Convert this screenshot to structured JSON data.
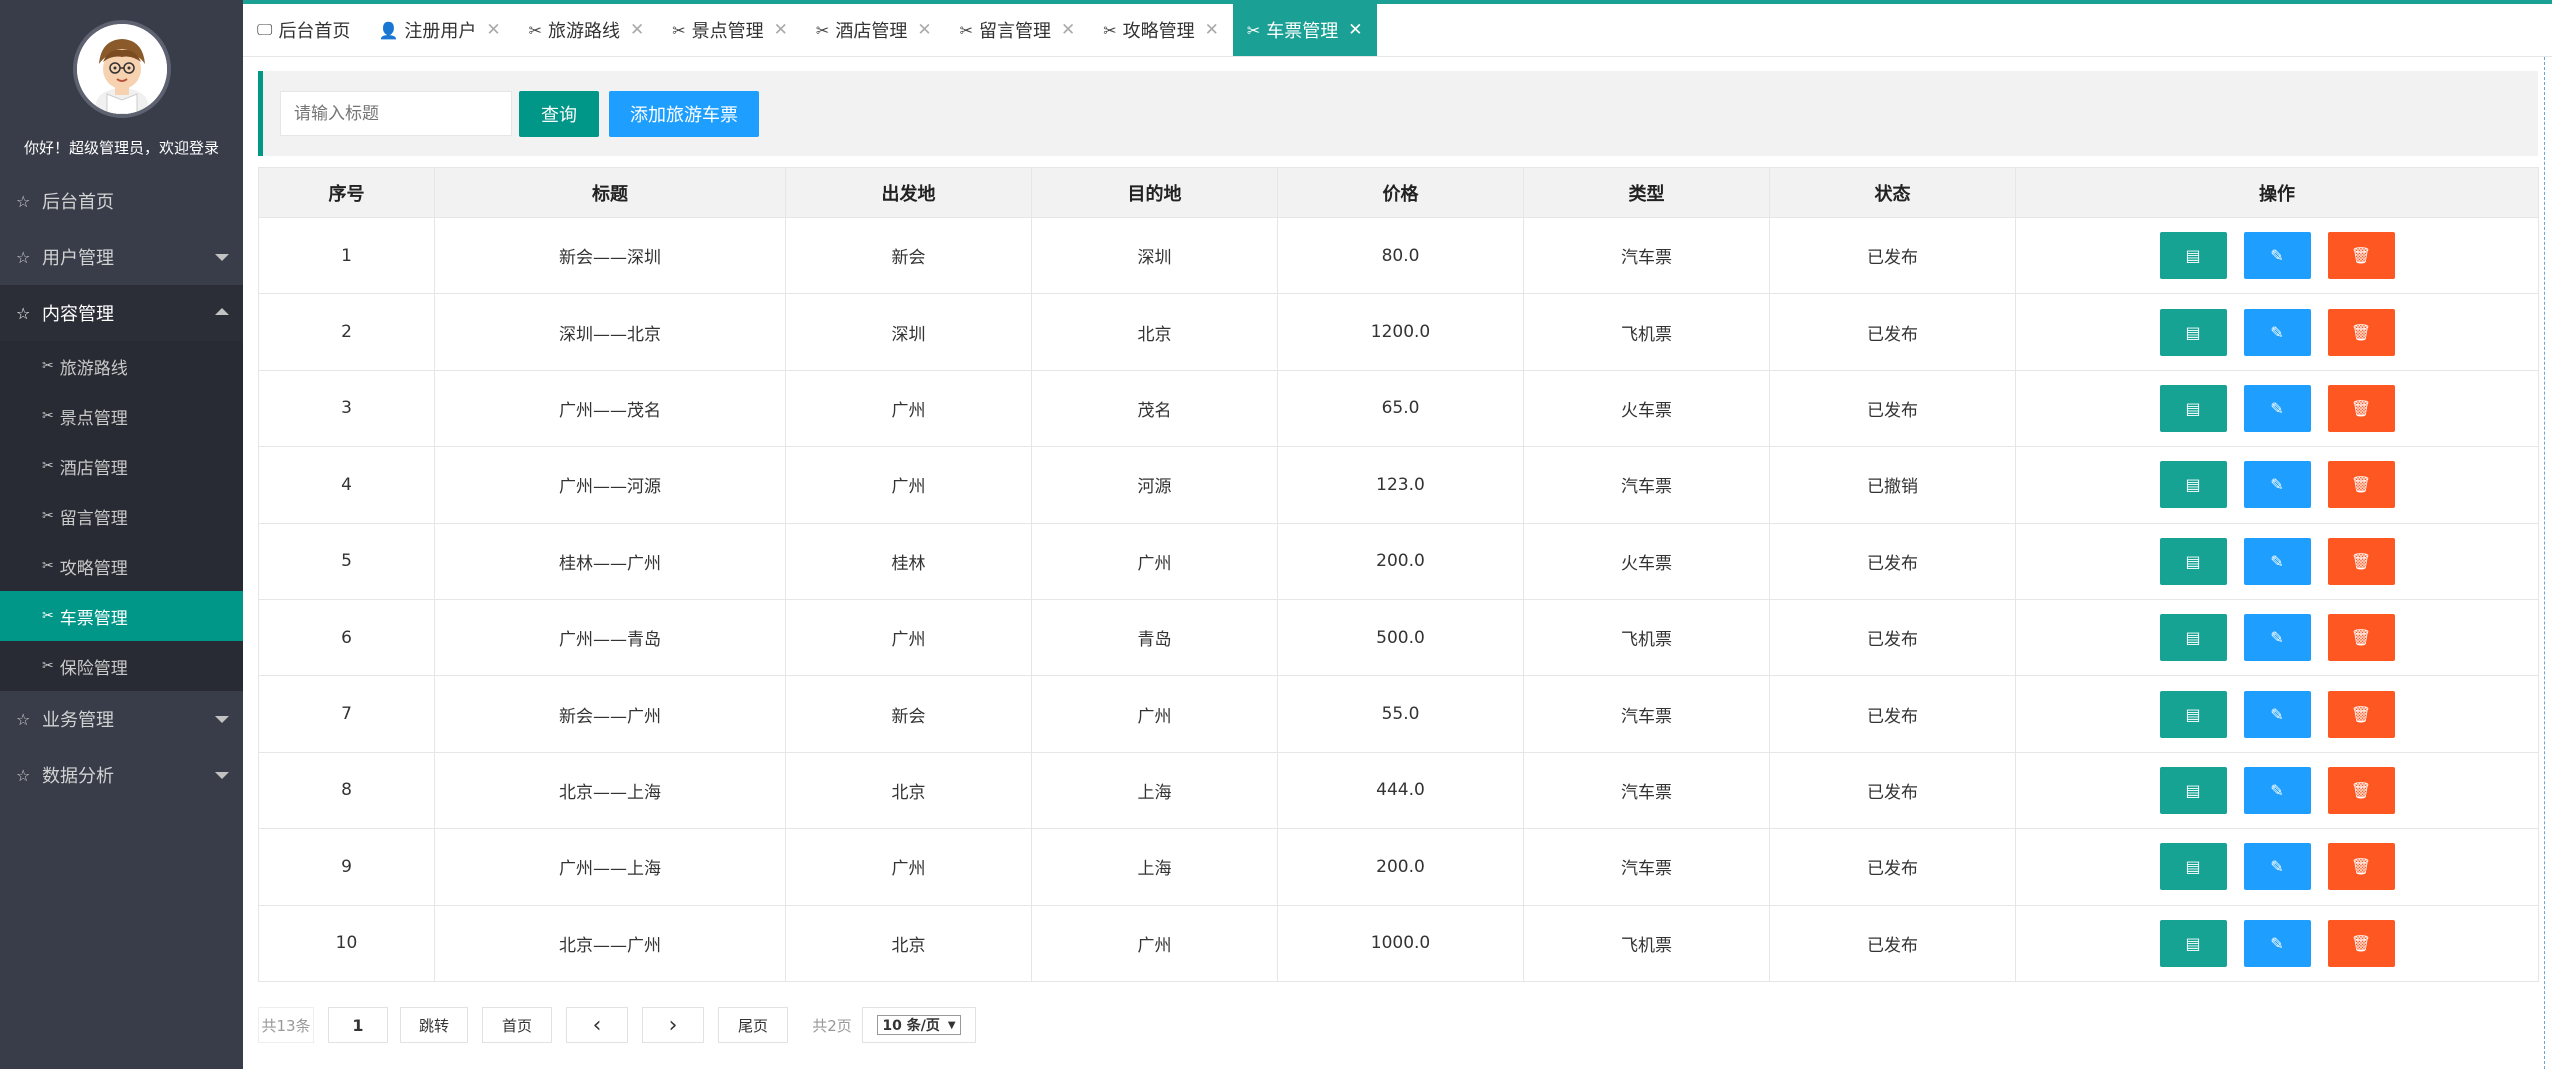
{
  "sidebar": {
    "greeting": "你好！超级管理员，欢迎登录",
    "menu": [
      {
        "label": "后台首页",
        "has_caret": false
      },
      {
        "label": "用户管理",
        "has_caret": true
      },
      {
        "label": "内容管理",
        "has_caret": true,
        "open": true
      }
    ],
    "submenu": [
      {
        "label": "旅游路线"
      },
      {
        "label": "景点管理"
      },
      {
        "label": "酒店管理"
      },
      {
        "label": "留言管理"
      },
      {
        "label": "攻略管理"
      },
      {
        "label": "车票管理",
        "active": true
      },
      {
        "label": "保险管理"
      }
    ],
    "menu_after": [
      {
        "label": "业务管理"
      },
      {
        "label": "数据分析"
      }
    ]
  },
  "tabs": [
    {
      "label": "后台首页",
      "icon": "monitor-icon",
      "closable": false
    },
    {
      "label": "注册用户",
      "icon": "user-icon",
      "closable": true
    },
    {
      "label": "旅游路线",
      "icon": "tools-icon",
      "closable": true
    },
    {
      "label": "景点管理",
      "icon": "tools-icon",
      "closable": true
    },
    {
      "label": "酒店管理",
      "icon": "tools-icon",
      "closable": true
    },
    {
      "label": "留言管理",
      "icon": "tools-icon",
      "closable": true
    },
    {
      "label": "攻略管理",
      "icon": "tools-icon",
      "closable": true
    },
    {
      "label": "车票管理",
      "icon": "tools-icon",
      "closable": true,
      "active": true
    }
  ],
  "search": {
    "placeholder": "请输入标题",
    "query_label": "查询",
    "add_label": "添加旅游车票"
  },
  "table": {
    "headers": [
      "序号",
      "标题",
      "出发地",
      "目的地",
      "价格",
      "类型",
      "状态",
      "操作"
    ],
    "rows": [
      [
        "1",
        "新会——深圳",
        "新会",
        "深圳",
        "80.0",
        "汽车票",
        "已发布"
      ],
      [
        "2",
        "深圳——北京",
        "深圳",
        "北京",
        "1200.0",
        "飞机票",
        "已发布"
      ],
      [
        "3",
        "广州——茂名",
        "广州",
        "茂名",
        "65.0",
        "火车票",
        "已发布"
      ],
      [
        "4",
        "广州——河源",
        "广州",
        "河源",
        "123.0",
        "汽车票",
        "已撤销"
      ],
      [
        "5",
        "桂林——广州",
        "桂林",
        "广州",
        "200.0",
        "火车票",
        "已发布"
      ],
      [
        "6",
        "广州——青岛",
        "广州",
        "青岛",
        "500.0",
        "飞机票",
        "已发布"
      ],
      [
        "7",
        "新会——广州",
        "新会",
        "广州",
        "55.0",
        "汽车票",
        "已发布"
      ],
      [
        "8",
        "北京——上海",
        "北京",
        "上海",
        "444.0",
        "汽车票",
        "已发布"
      ],
      [
        "9",
        "广州——上海",
        "广州",
        "上海",
        "200.0",
        "汽车票",
        "已发布"
      ],
      [
        "10",
        "北京——广州",
        "北京",
        "广州",
        "1000.0",
        "飞机票",
        "已发布"
      ]
    ]
  },
  "pager": {
    "total": "共13条",
    "page_value": "1",
    "jump": "跳转",
    "first": "首页",
    "last": "尾页",
    "pages": "共2页",
    "page_size": "10 条/页"
  },
  "colors": {
    "sidebar_bg": "#393d49",
    "accent": "#009688",
    "blue": "#1e9fff",
    "danger": "#ff5722"
  }
}
